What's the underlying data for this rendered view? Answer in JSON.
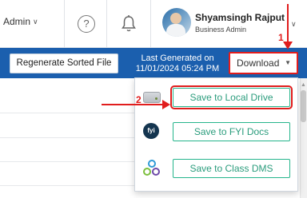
{
  "header": {
    "admin_menu_label": "Admin",
    "user_name": "Shyamsingh Rajput",
    "user_role": "Business Admin",
    "help_symbol": "?",
    "icons": [
      "help-icon",
      "bell-icon",
      "avatar",
      "chevron-down-icon"
    ]
  },
  "toolbar": {
    "regenerate_label": "Regenerate Sorted File",
    "last_generated_label": "Last Generated on",
    "last_generated_value": "11/01/2024 05:24 PM",
    "download_label": "Download"
  },
  "download_menu": {
    "items": [
      {
        "label": "Save to Local Drive",
        "icon": "drive-icon"
      },
      {
        "label": "Save to FYI Docs",
        "icon": "fyi-icon",
        "icon_text": "fyi"
      },
      {
        "label": "Save to Class DMS",
        "icon": "class-dms-icon"
      }
    ]
  },
  "annotations": {
    "step_1": "1",
    "step_2": "2",
    "color": "#e11d1d"
  },
  "colors": {
    "toolbar_blue": "#1b5fae",
    "menu_button_green": "#26b58c",
    "highlight_red": "#e11d1d"
  }
}
